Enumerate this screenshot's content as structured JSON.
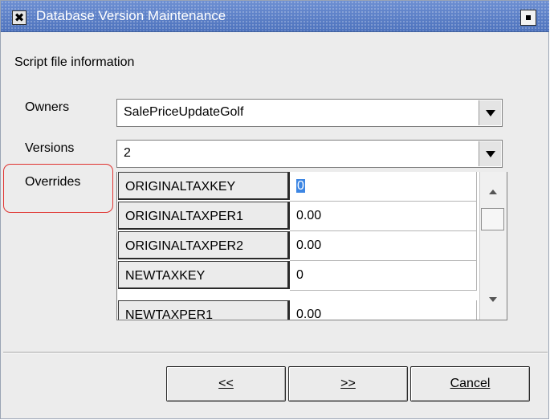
{
  "window": {
    "title": "Database Version Maintenance",
    "close_glyph": "✖"
  },
  "form": {
    "section_label": "Script file information",
    "owners": {
      "label": "Owners",
      "value": "SalePriceUpdateGolf"
    },
    "versions": {
      "label": "Versions",
      "value": "2"
    },
    "overrides": {
      "label": "Overrides",
      "rows": [
        {
          "key": "ORIGINALTAXKEY",
          "value": "0"
        },
        {
          "key": "ORIGINALTAXPER1",
          "value": "0.00"
        },
        {
          "key": "ORIGINALTAXPER2",
          "value": "0.00"
        },
        {
          "key": "NEWTAXKEY",
          "value": "0"
        },
        {
          "key": "NEWTAXPER1",
          "value": "0.00"
        }
      ]
    }
  },
  "buttons": {
    "prev_label": "<<",
    "next_label": ">>",
    "cancel_label": "Cancel"
  },
  "colors": {
    "titlebar": "#5a7fc6",
    "highlight": "#e0322f",
    "selection": "#3d86e3"
  }
}
